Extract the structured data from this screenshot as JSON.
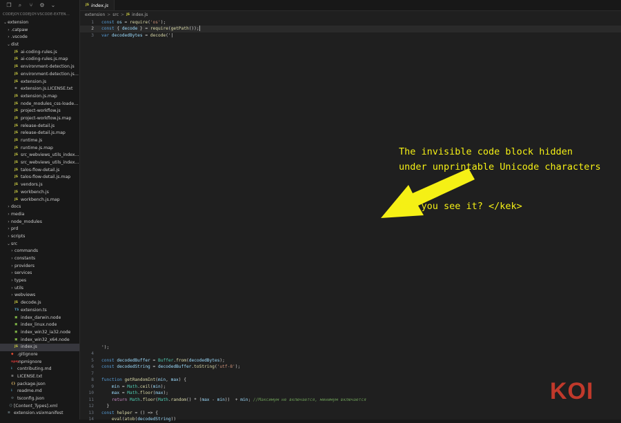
{
  "toolbar": {
    "icons": [
      "copy-icon",
      "search-icon",
      "source-control-icon",
      "settings-icon",
      "chevron-down-icon"
    ],
    "glyphs": [
      "❐",
      "⌕",
      "⑂",
      "⚙",
      "⌄"
    ]
  },
  "explorer": {
    "title": "CODEJOY.CODEJOY-VSCODE-EXTEN..."
  },
  "tree": [
    {
      "label": "extension",
      "icon": "",
      "indent": 0,
      "chevron": "⌄"
    },
    {
      "label": ".catpaw",
      "icon": "",
      "indent": 1,
      "chevron": "›"
    },
    {
      "label": ".vscode",
      "icon": "",
      "indent": 1,
      "chevron": "›"
    },
    {
      "label": "dist",
      "icon": "",
      "indent": 1,
      "chevron": "⌄"
    },
    {
      "label": "ai-coding-rules.js",
      "icon": "JS",
      "indent": 2
    },
    {
      "label": "ai-coding-rules.js.map",
      "icon": "JS",
      "indent": 2
    },
    {
      "label": "environment-detection.js",
      "icon": "JS",
      "indent": 2
    },
    {
      "label": "environment-detection.js.map",
      "icon": "JS",
      "indent": 2
    },
    {
      "label": "extension.js",
      "icon": "JS",
      "indent": 2
    },
    {
      "label": "extension.js.LICENSE.txt",
      "icon": "≡",
      "indent": 2,
      "kind": "txt"
    },
    {
      "label": "extension.js.map",
      "icon": "JS",
      "indent": 2
    },
    {
      "label": "node_modules_css-loader_di...",
      "icon": "JS",
      "indent": 2
    },
    {
      "label": "project-workflow.js",
      "icon": "JS",
      "indent": 2
    },
    {
      "label": "project-workflow.js.map",
      "icon": "JS",
      "indent": 2
    },
    {
      "label": "release-detail.js",
      "icon": "JS",
      "indent": 2
    },
    {
      "label": "release-detail.js.map",
      "icon": "JS",
      "indent": 2
    },
    {
      "label": "runtime.js",
      "icon": "JS",
      "indent": 2
    },
    {
      "label": "runtime.js.map",
      "icon": "JS",
      "indent": 2
    },
    {
      "label": "src_webviews_utils_index_ts...",
      "icon": "JS",
      "indent": 2
    },
    {
      "label": "src_webviews_utils_index_ts...",
      "icon": "JS",
      "indent": 2
    },
    {
      "label": "talos-flow-detail.js",
      "icon": "JS",
      "indent": 2
    },
    {
      "label": "talos-flow-detail.js.map",
      "icon": "JS",
      "indent": 2
    },
    {
      "label": "vendors.js",
      "icon": "JS",
      "indent": 2
    },
    {
      "label": "workbench.js",
      "icon": "JS",
      "indent": 2
    },
    {
      "label": "workbench.js.map",
      "icon": "JS",
      "indent": 2
    },
    {
      "label": "docs",
      "icon": "",
      "indent": 1,
      "chevron": "›"
    },
    {
      "label": "media",
      "icon": "",
      "indent": 1,
      "chevron": "›"
    },
    {
      "label": "node_modules",
      "icon": "",
      "indent": 1,
      "chevron": "›"
    },
    {
      "label": "prd",
      "icon": "",
      "indent": 1,
      "chevron": "›"
    },
    {
      "label": "scripts",
      "icon": "",
      "indent": 1,
      "chevron": "›"
    },
    {
      "label": "src",
      "icon": "",
      "indent": 1,
      "chevron": "⌄"
    },
    {
      "label": "commands",
      "icon": "",
      "indent": 2,
      "chevron": "›"
    },
    {
      "label": "constants",
      "icon": "",
      "indent": 2,
      "chevron": "›"
    },
    {
      "label": "providers",
      "icon": "",
      "indent": 2,
      "chevron": "›"
    },
    {
      "label": "services",
      "icon": "",
      "indent": 2,
      "chevron": "›"
    },
    {
      "label": "types",
      "icon": "",
      "indent": 2,
      "chevron": "›"
    },
    {
      "label": "utils",
      "icon": "",
      "indent": 2,
      "chevron": "›"
    },
    {
      "label": "webviews",
      "icon": "",
      "indent": 2,
      "chevron": "›"
    },
    {
      "label": "decode.js",
      "icon": "JS",
      "indent": 2
    },
    {
      "label": "extension.ts",
      "icon": "TS",
      "indent": 2,
      "kind": "ts"
    },
    {
      "label": "index_darwin.node",
      "icon": "▣",
      "indent": 2,
      "kind": "node"
    },
    {
      "label": "index_linux.node",
      "icon": "▣",
      "indent": 2,
      "kind": "node"
    },
    {
      "label": "index_win32_ia32.node",
      "icon": "▣",
      "indent": 2,
      "kind": "node"
    },
    {
      "label": "index_win32_x64.node",
      "icon": "▣",
      "indent": 2,
      "kind": "node"
    },
    {
      "label": "index.js",
      "icon": "JS",
      "indent": 2,
      "selected": true
    },
    {
      "label": ".gitignore",
      "icon": "◆",
      "indent": 1,
      "kind": "git"
    },
    {
      "label": ".npmignore",
      "icon": "npm",
      "indent": 1,
      "kind": "npm"
    },
    {
      "label": "contributing.md",
      "icon": "ℹ",
      "indent": 1,
      "kind": "md"
    },
    {
      "label": "LICENSE.txt",
      "icon": "≡",
      "indent": 1,
      "kind": "txt"
    },
    {
      "label": "package.json",
      "icon": "{}",
      "indent": 1,
      "kind": "json"
    },
    {
      "label": "readme.md",
      "icon": "ℹ",
      "indent": 1,
      "kind": "md"
    },
    {
      "label": "tsconfig.json",
      "icon": "⚙",
      "indent": 1,
      "kind": "cfg"
    },
    {
      "label": "[Content_Types].xml",
      "icon": "〈〉",
      "indent": 0,
      "kind": "cfg"
    },
    {
      "label": "extension.vsixmanifest",
      "icon": "≡",
      "indent": 0,
      "kind": "cfg"
    }
  ],
  "tab": {
    "icon": "JS",
    "label": "index.js"
  },
  "breadcrumb": {
    "parts": [
      "extension",
      "src",
      "index.js"
    ],
    "separator": ">",
    "file_icon": "JS"
  },
  "code": {
    "top_lines": [
      {
        "num": "1",
        "tokens": [
          [
            "kw",
            "const "
          ],
          [
            "var",
            "os"
          ],
          [
            "txt",
            " = "
          ],
          [
            "fn",
            "require"
          ],
          [
            "txt",
            "("
          ],
          [
            "str",
            "'os'"
          ],
          [
            "txt",
            ");"
          ]
        ]
      },
      {
        "num": "2",
        "current": true,
        "tokens": [
          [
            "kw",
            "const "
          ],
          [
            "txt",
            "{ "
          ],
          [
            "var",
            "decode"
          ],
          [
            "txt",
            " } = "
          ],
          [
            "fn",
            "require"
          ],
          [
            "txt",
            "("
          ],
          [
            "fn",
            "getPath"
          ],
          [
            "txt",
            "());"
          ]
        ]
      },
      {
        "num": "3",
        "tokens": [
          [
            "kw",
            "var "
          ],
          [
            "var",
            "decodedBytes"
          ],
          [
            "txt",
            " = "
          ],
          [
            "fn",
            "decode"
          ],
          [
            "txt",
            "('|"
          ]
        ]
      }
    ],
    "tail_line": {
      "num": "",
      "tokens": [
        [
          "txt",
          "');"
        ]
      ]
    },
    "bottom_lines": [
      {
        "num": "4",
        "tokens": []
      },
      {
        "num": "5",
        "tokens": [
          [
            "kw",
            "const "
          ],
          [
            "var",
            "decodedBuffer"
          ],
          [
            "txt",
            " = "
          ],
          [
            "cls",
            "Buffer"
          ],
          [
            "txt",
            "."
          ],
          [
            "fn",
            "from"
          ],
          [
            "txt",
            "("
          ],
          [
            "var",
            "decodedBytes"
          ],
          [
            "txt",
            ");"
          ]
        ]
      },
      {
        "num": "6",
        "tokens": [
          [
            "kw",
            "const "
          ],
          [
            "var",
            "decodedString"
          ],
          [
            "txt",
            " = "
          ],
          [
            "var",
            "decodedBuffer"
          ],
          [
            "txt",
            "."
          ],
          [
            "fn",
            "toString"
          ],
          [
            "txt",
            "("
          ],
          [
            "str",
            "'utf-8'"
          ],
          [
            "txt",
            ");"
          ]
        ]
      },
      {
        "num": "7",
        "tokens": []
      },
      {
        "num": "8",
        "tokens": [
          [
            "kw",
            "function "
          ],
          [
            "fn",
            "getRandomInt"
          ],
          [
            "txt",
            "("
          ],
          [
            "var",
            "min"
          ],
          [
            "txt",
            ", "
          ],
          [
            "var",
            "max"
          ],
          [
            "txt",
            ") {"
          ]
        ]
      },
      {
        "num": "9",
        "tokens": [
          [
            "txt",
            "    "
          ],
          [
            "var",
            "min"
          ],
          [
            "txt",
            " = "
          ],
          [
            "cls",
            "Math"
          ],
          [
            "txt",
            "."
          ],
          [
            "fn",
            "ceil"
          ],
          [
            "txt",
            "("
          ],
          [
            "var",
            "min"
          ],
          [
            "txt",
            ");"
          ]
        ]
      },
      {
        "num": "10",
        "tokens": [
          [
            "txt",
            "    "
          ],
          [
            "var",
            "max"
          ],
          [
            "txt",
            " = "
          ],
          [
            "cls",
            "Math"
          ],
          [
            "txt",
            "."
          ],
          [
            "fn",
            "floor"
          ],
          [
            "txt",
            "("
          ],
          [
            "var",
            "max"
          ],
          [
            "txt",
            ");"
          ]
        ]
      },
      {
        "num": "11",
        "tokens": [
          [
            "txt",
            "    "
          ],
          [
            "ctrl",
            "return "
          ],
          [
            "cls",
            "Math"
          ],
          [
            "txt",
            "."
          ],
          [
            "fn",
            "floor"
          ],
          [
            "txt",
            "("
          ],
          [
            "cls",
            "Math"
          ],
          [
            "txt",
            "."
          ],
          [
            "fn",
            "random"
          ],
          [
            "txt",
            "() * ("
          ],
          [
            "var",
            "max"
          ],
          [
            "txt",
            " - "
          ],
          [
            "var",
            "min"
          ],
          [
            "txt",
            "))  + "
          ],
          [
            "var",
            "min"
          ],
          [
            "txt",
            "; "
          ],
          [
            "cm",
            "//Максимум не включается, минимум включается"
          ]
        ]
      },
      {
        "num": "12",
        "tokens": [
          [
            "txt",
            "  }"
          ]
        ]
      },
      {
        "num": "13",
        "tokens": [
          [
            "kw",
            "const "
          ],
          [
            "fn",
            "helper"
          ],
          [
            "txt",
            " = () => {"
          ]
        ]
      },
      {
        "num": "14",
        "tokens": [
          [
            "txt",
            "    "
          ],
          [
            "fn",
            "eval"
          ],
          [
            "txt",
            "("
          ],
          [
            "fn",
            "atob"
          ],
          [
            "txt",
            "("
          ],
          [
            "var",
            "decodedString"
          ],
          [
            "txt",
            "))"
          ]
        ]
      }
    ]
  },
  "annotation": {
    "line1": "The invisible code block hidden",
    "line2": "under unprintable Unicode characters",
    "line3": "Can you see it? </kek>",
    "color": "#f5f015"
  },
  "logo": {
    "text": "KOI",
    "color": "#c0392b"
  }
}
